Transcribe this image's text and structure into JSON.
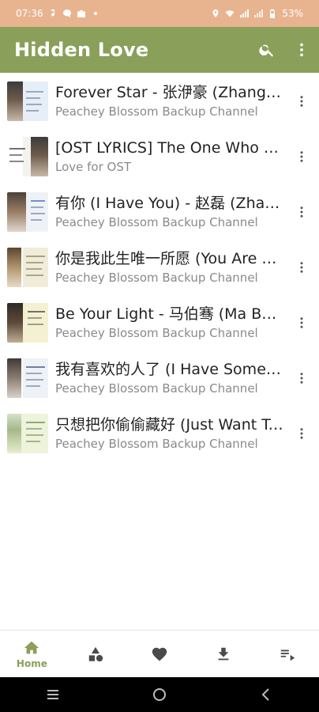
{
  "status_bar": {
    "time": "07:36",
    "battery": "53%",
    "left_icons": [
      "music-note-icon",
      "chat-bubble-icon",
      "briefcase-icon",
      "dot-icon"
    ],
    "right_icons": [
      "location-icon",
      "wifi-icon",
      "signal-icon",
      "signal-icon",
      "battery-icon"
    ]
  },
  "app_bar": {
    "title": "Hidden Love",
    "background": "#8aa05a"
  },
  "songs": [
    {
      "title": "Forever Star - 张洢豪 (Zhang Yihao)",
      "channel": "Peachey Blossom Backup Channel",
      "thumb_bg": "#e6eef7"
    },
    {
      "title": "[OST LYRICS] The One Who Loves You",
      "channel": "Love for OST",
      "thumb_bg": "#f2f2ee"
    },
    {
      "title": "有你 (I Have You) - 赵磊 (Zhao Lei)",
      "channel": "Peachey Blossom Backup Channel",
      "thumb_bg": "#eef1f6"
    },
    {
      "title": "你是我此生唯一所愿 (You Are My Only Wish)",
      "channel": "Peachey Blossom Backup Channel",
      "thumb_bg": "#f1ecd9"
    },
    {
      "title": "Be Your Light - 马伯骞 (Ma Boqian)",
      "channel": "Peachey Blossom Backup Channel",
      "thumb_bg": "#f4f0d2"
    },
    {
      "title": "我有喜欢的人了 (I Have Someone I Like)",
      "channel": "Peachey Blossom Backup Channel",
      "thumb_bg": "#eef1f6"
    },
    {
      "title": "只想把你偷偷藏好 (Just Want To Hide You)",
      "channel": "Peachey Blossom Backup Channel",
      "thumb_bg": "#eef3dc"
    }
  ],
  "bottom_nav": {
    "home_label": "Home",
    "accent": "#8aa05a"
  }
}
